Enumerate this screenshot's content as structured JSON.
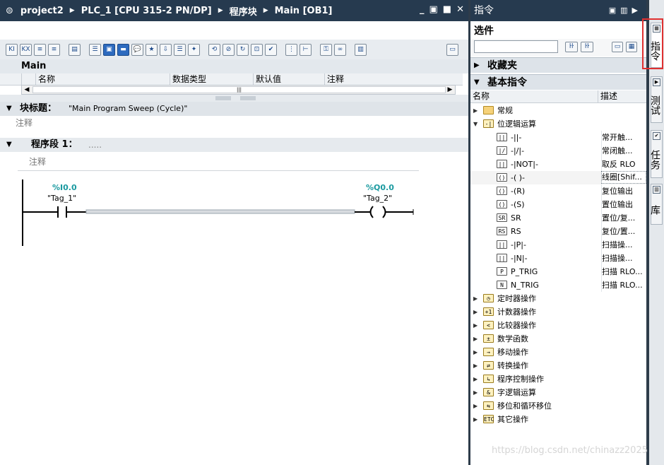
{
  "editor": {
    "breadcrumb": [
      "project2",
      "PLC_1 [CPU 315-2 PN/DP]",
      "程序块",
      "Main [OB1]"
    ],
    "window_controls": [
      "_",
      "▣",
      "■",
      "✕"
    ],
    "interface_title": "Main",
    "columns": [
      "名称",
      "数据类型",
      "默认值",
      "注释"
    ],
    "block_title_label": "块标题：",
    "block_title_value": "\"Main Program Sweep (Cycle)\"",
    "block_comment": "注释",
    "network_label": "程序段 1：",
    "network_dots": ".....",
    "network_comment": "注释",
    "contact": {
      "address": "%I0.0",
      "tag": "\"Tag_1\""
    },
    "coil": {
      "address": "%Q0.0",
      "tag": "\"Tag_2\""
    }
  },
  "panel": {
    "title": "指令",
    "options_label": "选件",
    "search_placeholder": "",
    "favorites_label": "收藏夹",
    "basic_label": "基本指令",
    "col_name": "名称",
    "col_desc": "描述",
    "items": [
      {
        "name": "常规",
        "desc": "",
        "icon": "folder",
        "expand": "▶",
        "level": 0
      },
      {
        "name": "位逻辑运算",
        "desc": "",
        "icon": "bit-logic",
        "expand": "▼",
        "level": 0
      },
      {
        "name": "-||-",
        "desc": "常开触...",
        "icon": "contact-no",
        "level": 1
      },
      {
        "name": "-|/|-",
        "desc": "常闭触...",
        "icon": "contact-nc",
        "level": 1
      },
      {
        "name": "-|NOT|-",
        "desc": "取反 RLO",
        "icon": "not",
        "level": 1
      },
      {
        "name": "-( )-",
        "desc": "线圈[Shif...",
        "icon": "coil",
        "level": 1
      },
      {
        "name": "-(R)",
        "desc": "复位输出",
        "icon": "coil-r",
        "level": 1
      },
      {
        "name": "-(S)",
        "desc": "置位输出",
        "icon": "coil-s",
        "level": 1
      },
      {
        "name": "SR",
        "desc": "置位/复...",
        "icon": "sr",
        "level": 1
      },
      {
        "name": "RS",
        "desc": "复位/置...",
        "icon": "rs",
        "level": 1
      },
      {
        "name": "-|P|-",
        "desc": "扫描操...",
        "icon": "p-edge",
        "level": 1
      },
      {
        "name": "-|N|-",
        "desc": "扫描操...",
        "icon": "n-edge",
        "level": 1
      },
      {
        "name": "P_TRIG",
        "desc": "扫描 RLO...",
        "icon": "p-trig",
        "level": 1
      },
      {
        "name": "N_TRIG",
        "desc": "扫描 RLO...",
        "icon": "n-trig",
        "level": 1
      },
      {
        "name": "定时器操作",
        "desc": "",
        "icon": "timer",
        "expand": "▶",
        "level": 0
      },
      {
        "name": "计数器操作",
        "desc": "",
        "icon": "counter",
        "expand": "▶",
        "level": 0
      },
      {
        "name": "比较器操作",
        "desc": "",
        "icon": "compare",
        "expand": "▶",
        "level": 0
      },
      {
        "name": "数学函数",
        "desc": "",
        "icon": "math",
        "expand": "▶",
        "level": 0
      },
      {
        "name": "移动操作",
        "desc": "",
        "icon": "move",
        "expand": "▶",
        "level": 0
      },
      {
        "name": "转换操作",
        "desc": "",
        "icon": "convert",
        "expand": "▶",
        "level": 0
      },
      {
        "name": "程序控制操作",
        "desc": "",
        "icon": "program-control",
        "expand": "▶",
        "level": 0
      },
      {
        "name": "字逻辑运算",
        "desc": "",
        "icon": "word-logic",
        "expand": "▶",
        "level": 0
      },
      {
        "name": "移位和循环移位",
        "desc": "",
        "icon": "shift",
        "expand": "▶",
        "level": 0
      },
      {
        "name": "其它操作",
        "desc": "",
        "icon": "etc",
        "expand": "▶",
        "level": 0
      }
    ]
  },
  "side_tabs": [
    "指令",
    "测试",
    "任务",
    "库"
  ],
  "watermark": "https://blog.csdn.net/chinazz2025",
  "colors": {
    "titlebar": "#263a4f",
    "address": "#1b9aa0",
    "highlight": "#e03030"
  }
}
